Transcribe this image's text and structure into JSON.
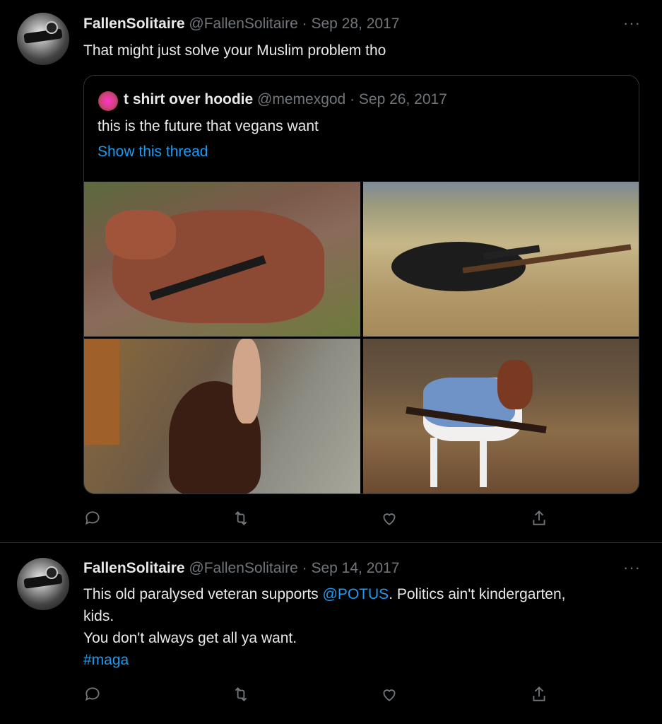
{
  "tweets": [
    {
      "name": "FallenSolitaire",
      "handle": "@FallenSolitaire",
      "sep": "·",
      "date": "Sep 28, 2017",
      "text": "That might just solve your Muslim problem tho",
      "quote": {
        "name": "t shirt over hoodie",
        "handle": "@memexgod",
        "sep": "·",
        "date": "Sep 26, 2017",
        "text": "this is the future that vegans want",
        "link": "Show this thread"
      }
    },
    {
      "name": "FallenSolitaire",
      "handle": "@FallenSolitaire",
      "sep": "·",
      "date": "Sep 14, 2017",
      "text_pre": "This old paralysed veteran supports ",
      "mention": "@POTUS",
      "text_post": ". Politics ain't kindergarten,",
      "line2": "kids.",
      "line3": "You don't always get all ya want.",
      "hashtag": "#maga"
    }
  ],
  "more_label": "···",
  "icons": [
    "reply-icon",
    "retweet-icon",
    "like-icon",
    "share-icon"
  ],
  "colors": {
    "background": "#000000",
    "text": "#e7e9ea",
    "muted": "#71767b",
    "accent": "#1d9bf0",
    "border": "#2f3336"
  }
}
